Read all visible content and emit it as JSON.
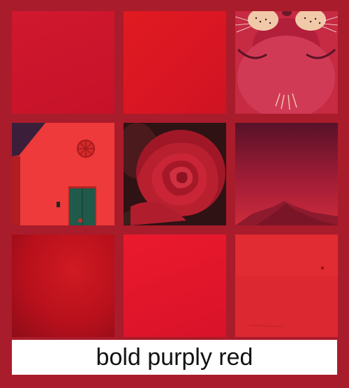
{
  "background_color": "#a91c2b",
  "tiles": [
    {
      "name": "dark-red-texture",
      "color": "#c8142c"
    },
    {
      "name": "red-texture",
      "color": "#da1723"
    },
    {
      "name": "cartoon-cat-closeup",
      "color": "#c2263f"
    },
    {
      "name": "red-house-with-green-door",
      "color": "#ef3b3b"
    },
    {
      "name": "red-rose",
      "color": "#b81a2a"
    },
    {
      "name": "purple-red-mountain-sky",
      "color": "#9a1a33"
    },
    {
      "name": "red-gradient-blur",
      "color": "#b8101c"
    },
    {
      "name": "bright-red-texture",
      "color": "#e0162c"
    },
    {
      "name": "red-wall-texture",
      "color": "#dd2a32"
    }
  ],
  "caption": "bold purply red"
}
